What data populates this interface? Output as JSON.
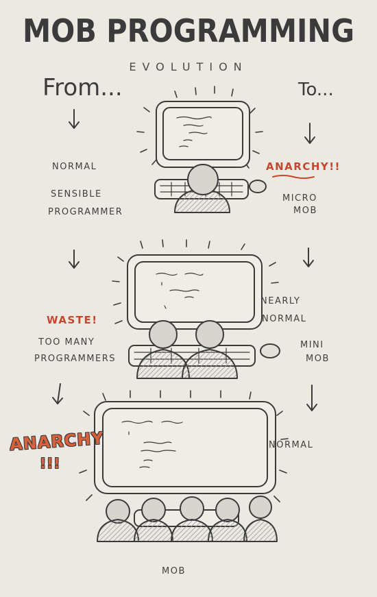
{
  "header": {
    "title": "MOB PROGRAMMING",
    "subtitle": "EVOLUTION",
    "from_label": "From...",
    "to_label": "To..."
  },
  "stage1": {
    "left_labels": [
      "NORMAL",
      "SENSIBLE",
      "PROGRAMMER"
    ],
    "right_exclaim": "ANARCHY!!",
    "right_labels": [
      "MICRO",
      "MOB"
    ]
  },
  "stage2": {
    "left_exclaim": "WASTE!",
    "left_labels": [
      "TOO MANY",
      "PROGRAMMERS"
    ],
    "right_labels": [
      "NEARLY",
      "NORMAL",
      "MINI",
      "MOB"
    ]
  },
  "stage3": {
    "left_exclaim": "ANARCHY",
    "left_exclaim2": "!!!",
    "right_label": "NORMAL",
    "bottom_label": "MOB"
  },
  "colors": {
    "accent": "#c8462c",
    "ink": "#3a3a3a",
    "paper": "#ebe9e2"
  }
}
